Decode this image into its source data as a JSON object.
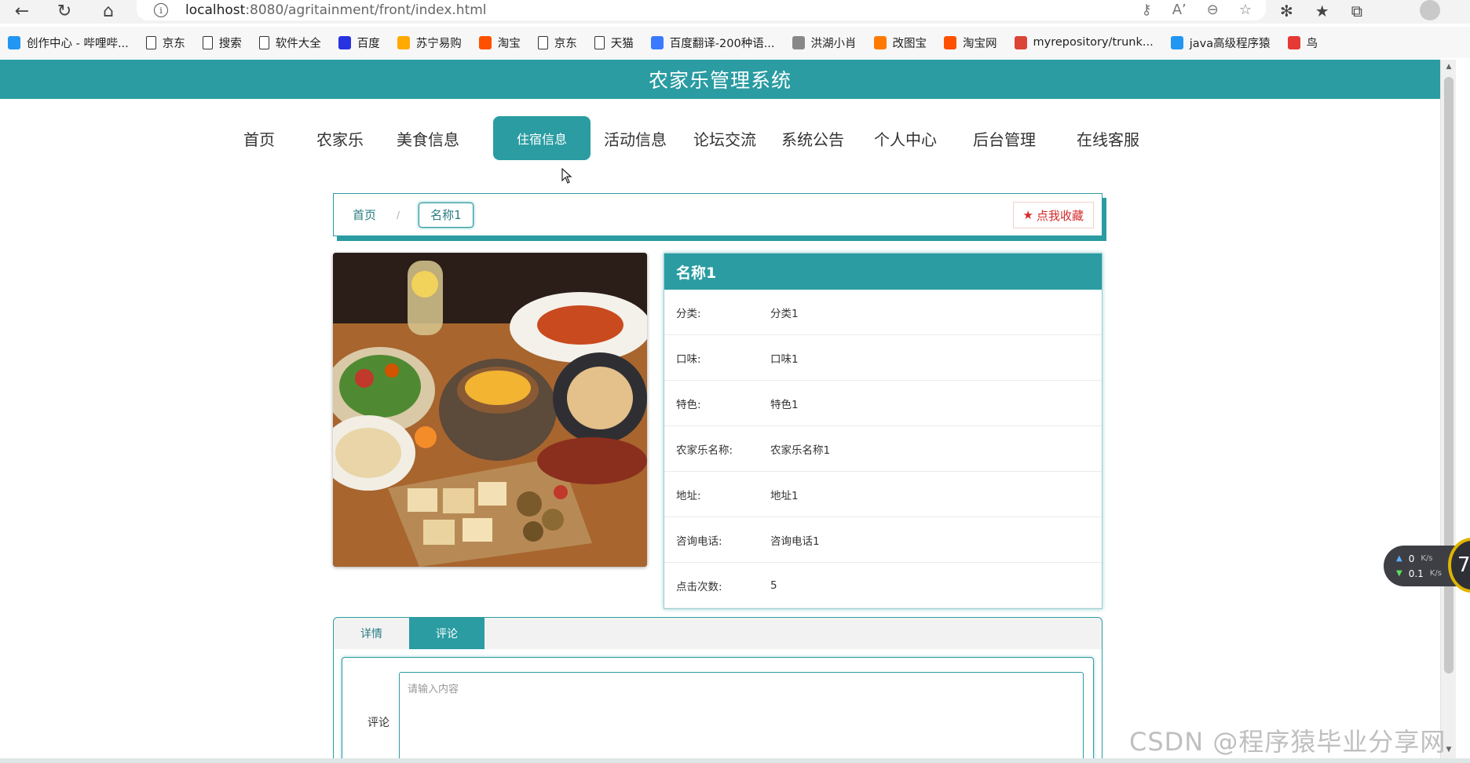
{
  "browser": {
    "url_host": "localhost",
    "url_path": ":8080/agritainment/front/index.html",
    "bookmarks": [
      {
        "label": "创作中心 - 哔哩哔...",
        "icon": "bilibili-icon",
        "color": "#2196f3"
      },
      {
        "label": "京东",
        "icon": "document-icon"
      },
      {
        "label": "搜索",
        "icon": "document-icon"
      },
      {
        "label": "软件大全",
        "icon": "document-icon"
      },
      {
        "label": "百度",
        "icon": "baidu-paw-icon",
        "color": "#2932e1"
      },
      {
        "label": "苏宁易购",
        "icon": "suning-icon",
        "color": "#ffaa00"
      },
      {
        "label": "淘宝",
        "icon": "taobao-icon",
        "color": "#ff5000"
      },
      {
        "label": "京东",
        "icon": "document-icon"
      },
      {
        "label": "天猫",
        "icon": "document-icon"
      },
      {
        "label": "百度翻译-200种语...",
        "icon": "translate-icon",
        "color": "#3a7afe"
      },
      {
        "label": "洪湖小肖",
        "icon": "bird-icon",
        "color": "#888888"
      },
      {
        "label": "改图宝",
        "icon": "gaitubao-icon",
        "color": "#ff7a00"
      },
      {
        "label": "淘宝网",
        "icon": "taobao-icon",
        "color": "#ff5000"
      },
      {
        "label": "myrepository/trunk...",
        "icon": "chrome-icon",
        "color": "#db4437"
      },
      {
        "label": "java高级程序猿",
        "icon": "bilibili-icon",
        "color": "#2196f3"
      },
      {
        "label": "鸟",
        "icon": "bird-red-icon",
        "color": "#e53935"
      }
    ]
  },
  "header": {
    "title": "农家乐管理系统"
  },
  "menu": {
    "items": [
      "首页",
      "农家乐",
      "美食信息",
      "住宿信息",
      "活动信息",
      "论坛交流",
      "系统公告",
      "个人中心",
      "后台管理",
      "在线客服"
    ],
    "active": "住宿信息"
  },
  "breadcrumb": {
    "home": "首页",
    "separator": "/",
    "current": "名称1",
    "favorite": "点我收藏"
  },
  "detail": {
    "title": "名称1",
    "rows": [
      {
        "label": "分类:",
        "value": "分类1"
      },
      {
        "label": "口味:",
        "value": "口味1"
      },
      {
        "label": "特色:",
        "value": "特色1"
      },
      {
        "label": "农家乐名称:",
        "value": "农家乐名称1"
      },
      {
        "label": "地址:",
        "value": "地址1"
      },
      {
        "label": "咨询电话:",
        "value": "咨询电话1"
      },
      {
        "label": "点击次数:",
        "value": "5"
      }
    ]
  },
  "tabs": {
    "items": [
      "详情",
      "评论"
    ],
    "active": "评论"
  },
  "comment": {
    "label": "评论",
    "placeholder": "请输入内容"
  },
  "netspeed": {
    "up": "0",
    "down": "0.1",
    "unit": "K/s",
    "badge": "7"
  },
  "watermark": "CSDN @程序猿毕业分享网",
  "colors": {
    "accent": "#2a9ca2",
    "favorite": "#d62b2b"
  }
}
